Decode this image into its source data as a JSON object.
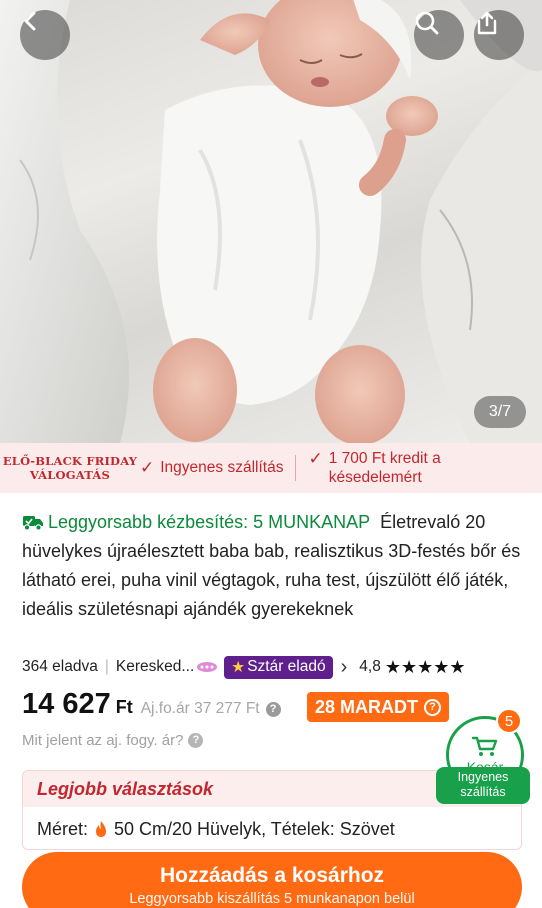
{
  "gallery": {
    "counter": "3/7",
    "icons": {
      "back": "chevron-left-icon",
      "search": "search-icon",
      "share": "share-icon"
    }
  },
  "promo": {
    "black_friday_line1": "ELŐ-BLACK FRIDAY",
    "black_friday_line2": "VÁLOGATÁS",
    "free_shipping": "Ingyenes szállítás",
    "credit_line1": "1 700 Ft kredit a",
    "credit_line2": "késedelemért",
    "check_icon": "check-icon"
  },
  "product": {
    "fast_delivery": "Leggyorsabb kézbesítés: 5 MUNKANAP",
    "title": "Életrevaló 20 hüvelykes újraélesztett baba bab, realisztikus 3D-festés bőr és látható erei, puha vinil végtagok, ruha test, újszülött élő játék, ideális születésnapi ajándék gyerekeknek",
    "sold": "364 eladva",
    "seller": "Keresked...",
    "star_seller": "Sztár eladó",
    "rating": "4,8",
    "stars": "★★★★★",
    "rating_value": 4.8
  },
  "price": {
    "amount": "14 627",
    "currency": "Ft",
    "reference": "Aj.fo.ár 37 277 Ft",
    "left_badge": "28 MARADT",
    "what_is": "Mit jelent az aj. fogy. ár?"
  },
  "cart": {
    "label": "Kosár",
    "count": "5",
    "shipping_line1": "Ingyenes",
    "shipping_line2": "szállítás"
  },
  "choices": {
    "heading": "Legjobb választások",
    "size_label": "Méret:",
    "size_value": "50 Cm/20 Hüvelyk, Tételek: Szövet"
  },
  "add_button": {
    "label": "Hozzáadás a kosárhoz",
    "sub": "Leggyorsabb kiszállítás 5 munkanapon belül"
  },
  "colors": {
    "accent": "#ff6a13",
    "promo_red": "#c2262e",
    "green": "#18a14a",
    "purple_badge": "#5f1f8c"
  }
}
